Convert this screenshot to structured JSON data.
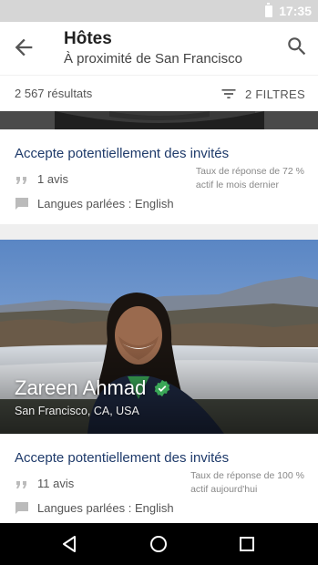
{
  "status_bar": {
    "time": "17:35"
  },
  "app_bar": {
    "title": "Hôtes",
    "subtitle": "À proximité de San Francisco"
  },
  "results": {
    "count": "2 567 résultats",
    "filter_label": "2 FILTRES"
  },
  "cards": [
    {
      "accepts_guests": "Accepte potentiellement des invités",
      "reviews": "1 avis",
      "languages": "Langues parlées : English",
      "response_rate_line1": "Taux de réponse de 72 %",
      "response_rate_line2": "actif le mois dernier"
    },
    {
      "host_name": "Zareen Ahmad",
      "location": "San Francisco, CA, USA",
      "accepts_guests": "Accepte potentiellement des invités",
      "reviews": "11 avis",
      "languages": "Langues parlées : English",
      "response_rate_line1": "Taux de réponse de 100 %",
      "response_rate_line2": "actif aujourd'hui"
    }
  ],
  "colors": {
    "accent": "#1e3a6a",
    "verified": "#3aa757"
  },
  "icons": [
    "battery-icon",
    "back-arrow-icon",
    "search-icon",
    "filter-icon",
    "quote-icon",
    "chat-icon",
    "verified-icon",
    "nav-back-icon",
    "nav-home-icon",
    "nav-recents-icon"
  ]
}
